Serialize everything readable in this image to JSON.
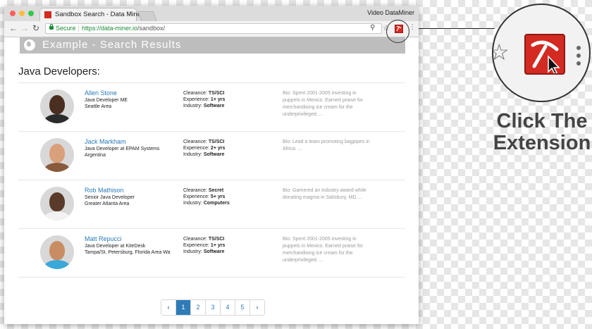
{
  "browser": {
    "tab_title": "Sandbox Search - Data Miner",
    "tab_close": "×",
    "profile_name": "Video DataMiner",
    "secure_label": "Secure",
    "url_host": "https://data-miner.io",
    "url_path": "/sandbox/",
    "nav": {
      "back": "←",
      "forward": "→",
      "reload": "↻"
    },
    "menu_glyph": "⋮",
    "star_glyph": "☆",
    "zoom_glyph": "⚲",
    "traffic_colors": {
      "close": "#fc605c",
      "minimize": "#fdbc40",
      "maximize": "#34c84a"
    }
  },
  "page": {
    "banner_title": "Example - Search Results",
    "heading": "Java Developers:",
    "developers": [
      {
        "name": "Allen Stone",
        "title": "Java Developer ME",
        "location": "Seattle Area",
        "clearance_label": "Clearance:",
        "clearance": "TS/SCI",
        "experience_label": "Experience:",
        "experience": "1+ yrs",
        "industry_label": "Industry:",
        "industry": "Software",
        "bio": "Bio: Spent 2001-2005 investing in puppets in Mexico. Earned praise for merchandising ice cream for the underprivileged. ...",
        "skin": "#4a2e1f",
        "shirt": "#2b2b2b"
      },
      {
        "name": "Jack Markham",
        "title": "Java Developer at EPAM Systems",
        "location": "Argentina",
        "clearance_label": "Clearance:",
        "clearance": "TS/SCI",
        "experience_label": "Experience:",
        "experience": "2+ yrs",
        "industry_label": "Industry:",
        "industry": "Software",
        "bio": "Bio: Lead a team promoting bagpipes in Africa. ...",
        "skin": "#d9a07c",
        "shirt": "#8a5a3c"
      },
      {
        "name": "Rob Mathison",
        "title": "Senior Java Developer",
        "location": "Greater Atlanta Area",
        "clearance_label": "Clearance:",
        "clearance": "Secret",
        "experience_label": "Experience:",
        "experience": "5+ yrs",
        "industry_label": "Industry:",
        "industry": "Computers",
        "bio": "Bio: Garnered an industry award while donating magma in Salisbury, MD....",
        "skin": "#5a3a28",
        "shirt": "#f2f2f2"
      },
      {
        "name": "Matt Repucci",
        "title": "Java Developer at KiteDesk",
        "location": "Tampa/St. Petersburg, Florida Area Wa",
        "clearance_label": "Clearance:",
        "clearance": "TS/SCI",
        "experience_label": "Experience:",
        "experience": "1+ yrs",
        "industry_label": "Industry:",
        "industry": "Software",
        "bio": "Bio: Spent 2001-2005 investing in puppets in Mexico. Earned praise for merchandising ice cream for the underprivileged. ...",
        "skin": "#c98d63",
        "shirt": "#3aa8d8"
      }
    ],
    "pagination": {
      "prev": "‹",
      "next": "›",
      "pages": [
        "1",
        "2",
        "3",
        "4",
        "5"
      ],
      "current_page": 1
    }
  },
  "callout": {
    "line1": "Click The",
    "line2": "Extension"
  },
  "colors": {
    "extension_red": "#d32a22",
    "link_blue": "#2a7ab7",
    "banner_gray": "#bdbdbd",
    "pager_active": "#2e7bb8"
  }
}
